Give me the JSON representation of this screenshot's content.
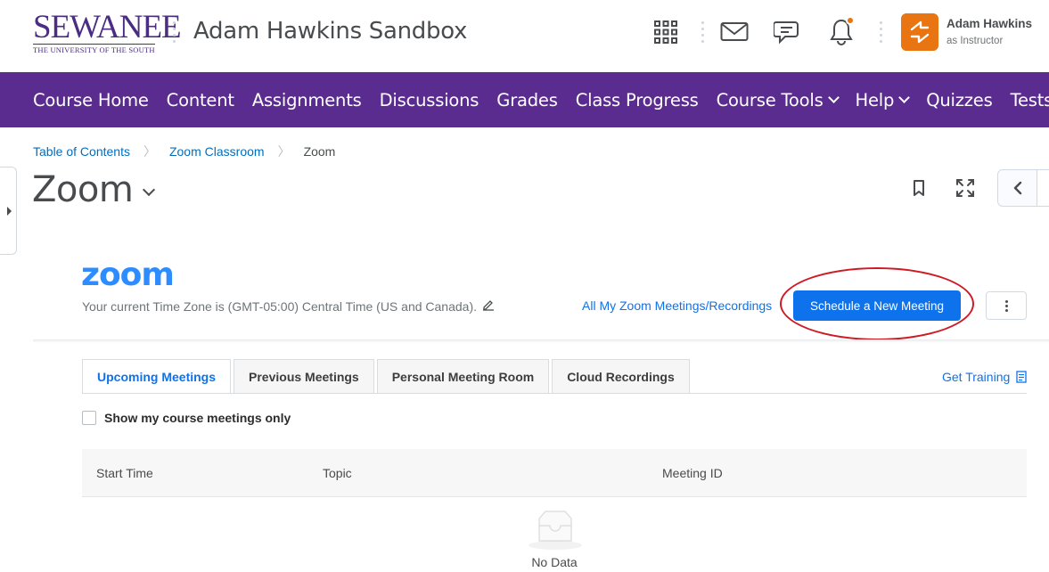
{
  "header": {
    "logo_word": "SEWANEE",
    "logo_sub": "THE UNIVERSITY OF THE SOUTH",
    "course_title": "Adam Hawkins Sandbox",
    "icons": [
      "grid-icon",
      "mail-icon",
      "chat-icon",
      "bell-icon"
    ],
    "user": {
      "name": "Adam Hawkins",
      "role": "as Instructor"
    },
    "colors": {
      "brand_purple": "#4b2e83",
      "accent_orange": "#e87511"
    }
  },
  "navbar": {
    "color": "#5b2c8f",
    "items": [
      {
        "label": "Course Home",
        "dropdown": false
      },
      {
        "label": "Content",
        "dropdown": false
      },
      {
        "label": "Assignments",
        "dropdown": false
      },
      {
        "label": "Discussions",
        "dropdown": false
      },
      {
        "label": "Grades",
        "dropdown": false
      },
      {
        "label": "Class Progress",
        "dropdown": false
      },
      {
        "label": "Course Tools",
        "dropdown": true
      },
      {
        "label": "Help",
        "dropdown": true
      },
      {
        "label": "Quizzes",
        "dropdown": false
      },
      {
        "label": "Tests",
        "dropdown": false
      }
    ]
  },
  "breadcrumb": {
    "items": [
      "Table of Contents",
      "Zoom Classroom"
    ],
    "current": "Zoom"
  },
  "page": {
    "title": "Zoom"
  },
  "zoom": {
    "logo": "zoom",
    "timezone_text": "Your current Time Zone is (GMT-05:00) Central Time (US and Canada).",
    "all_link": "All My Zoom Meetings/Recordings",
    "schedule_button": "Schedule a New Meeting",
    "get_training": "Get Training",
    "tabs": [
      {
        "label": "Upcoming Meetings",
        "active": true
      },
      {
        "label": "Previous Meetings",
        "active": false
      },
      {
        "label": "Personal Meeting Room",
        "active": false
      },
      {
        "label": "Cloud Recordings",
        "active": false
      }
    ],
    "checkbox_label": "Show my course meetings only",
    "checkbox_checked": false,
    "table": {
      "columns": [
        "Start Time",
        "Topic",
        "Meeting ID"
      ],
      "rows": [],
      "empty_text": "No Data"
    },
    "colors": {
      "zoom_blue": "#0e72ed",
      "annotation_red": "#cf1a24"
    }
  }
}
